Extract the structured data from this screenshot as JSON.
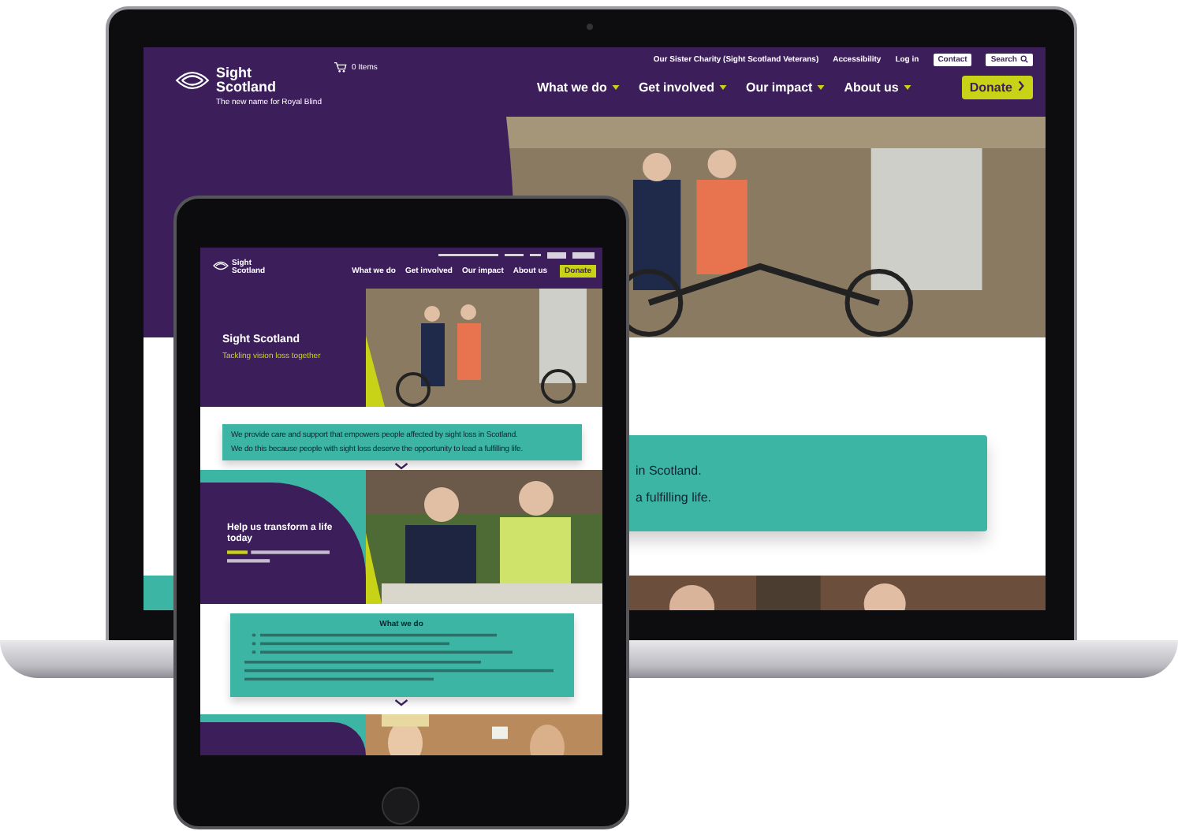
{
  "laptop": {
    "header": {
      "logo": "Sight Scotland",
      "tagline": "The new name for Royal Blind",
      "cart": "0 Items",
      "top_links": [
        "Our Sister Charity (Sight Scotland Veterans)",
        "Accessibility",
        "Log in"
      ],
      "contact": "Contact",
      "search": "Search",
      "nav": [
        "What we do",
        "Get involved",
        "Our impact",
        "About us"
      ],
      "donate": "Donate"
    },
    "card_lines": [
      "in Scotland.",
      "a fulfilling life."
    ]
  },
  "tablet": {
    "header": {
      "logo": "Sight Scotland",
      "nav": [
        "What we do",
        "Get involved",
        "Our impact",
        "About us"
      ],
      "donate": "Donate"
    },
    "hero": {
      "title": "Sight Scotland",
      "subtitle": "Tackling vision loss together"
    },
    "intro_lines": [
      "We provide care and support that empowers people affected by sight loss in Scotland.",
      "We do this because people with sight loss deserve the opportunity to lead a fulfilling life."
    ],
    "transform": {
      "title": "Help us transform a life today"
    },
    "what_we_do": {
      "title": "What we do"
    }
  }
}
